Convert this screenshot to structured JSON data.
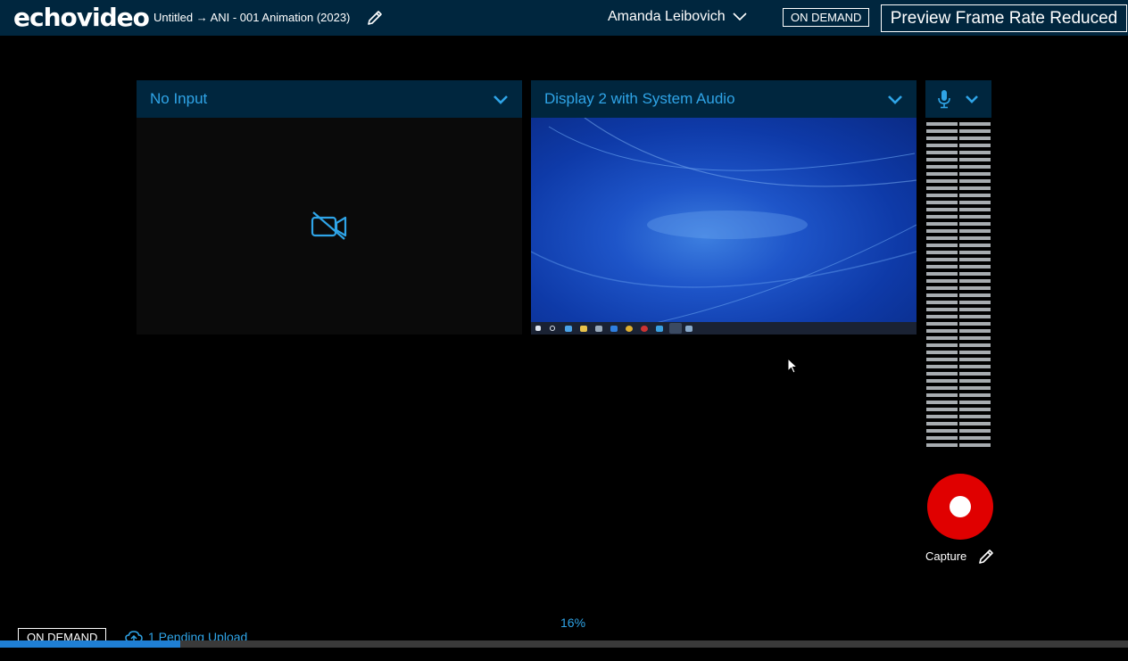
{
  "app": {
    "logo": "echovideo"
  },
  "header": {
    "breadcrumb": "Untitled → ANI - 001 Animation (2023)",
    "user_name": "Amanda Leibovich",
    "mode_badge": "ON DEMAND",
    "frame_warning": "Preview Frame Rate Reduced"
  },
  "sources": [
    {
      "label": "No Input",
      "state": "no-video"
    },
    {
      "label": "Display 2 with System Audio",
      "state": "screen-preview"
    }
  ],
  "capture": {
    "label": "Capture"
  },
  "upload": {
    "percent_text": "16%",
    "progress": 0.16,
    "mode_badge": "ON DEMAND",
    "pending_text": "1 Pending Upload"
  },
  "colors": {
    "accent": "#2fa4e7",
    "header_bg": "#00263e",
    "record": "#e00000"
  },
  "icons": [
    "edit-icon",
    "chevron-down-icon",
    "video-off-icon",
    "microphone-icon",
    "record-icon",
    "cloud-upload-icon"
  ]
}
